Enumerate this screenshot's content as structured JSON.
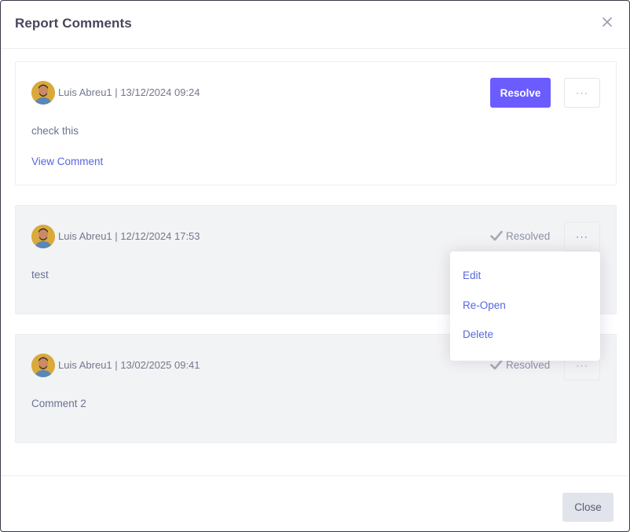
{
  "modal": {
    "title": "Report Comments",
    "footer": {
      "close_label": "Close"
    }
  },
  "comments": [
    {
      "author": "Luis Abreu1",
      "separator": "|",
      "timestamp": "13/12/2024 09:24",
      "text": "check this",
      "view_link": "View Comment",
      "action_label": "Resolve",
      "more_label": "···"
    },
    {
      "author": "Luis Abreu1",
      "separator": "|",
      "timestamp": "12/12/2024 17:53",
      "text": "test",
      "status_label": "Resolved",
      "more_label": "···"
    },
    {
      "author": "Luis Abreu1",
      "separator": "|",
      "timestamp": "13/02/2025 09:41",
      "text": "Comment 2",
      "status_label": "Resolved",
      "more_label": "···"
    }
  ],
  "dropdown": {
    "items": [
      "Edit",
      "Re-Open",
      "Delete"
    ]
  },
  "icons": {
    "close": "close-icon",
    "check": "check-icon",
    "more": "more-horizontal-icon",
    "avatar": "user-avatar"
  },
  "colors": {
    "accent": "#6a5cff",
    "link": "#5867dd",
    "resolved_bg": "#f2f3f5"
  }
}
